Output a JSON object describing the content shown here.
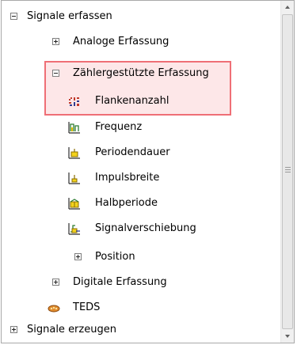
{
  "tree": {
    "items": [
      {
        "label": "Signale erfassen",
        "toggle": "minus",
        "icon": ""
      },
      {
        "label": "Analoge Erfassung",
        "toggle": "plus",
        "icon": ""
      },
      {
        "label": "Zählergestützte Erfassung",
        "toggle": "minus",
        "icon": ""
      },
      {
        "label": "Flankenanzahl",
        "toggle": "",
        "icon": "edge-count-icon"
      },
      {
        "label": "Frequenz",
        "toggle": "",
        "icon": "frequency-icon"
      },
      {
        "label": "Periodendauer",
        "toggle": "",
        "icon": "period-icon"
      },
      {
        "label": "Impulsbreite",
        "toggle": "",
        "icon": "pulse-width-icon"
      },
      {
        "label": "Halbperiode",
        "toggle": "",
        "icon": "semi-period-icon"
      },
      {
        "label": "Signalverschiebung",
        "toggle": "",
        "icon": "two-edge-separation-icon"
      },
      {
        "label": "Position",
        "toggle": "plus",
        "icon": ""
      },
      {
        "label": "Digitale Erfassung",
        "toggle": "plus",
        "icon": ""
      },
      {
        "label": "TEDS",
        "toggle": "",
        "icon": "teds-icon"
      },
      {
        "label": "Signale erzeugen",
        "toggle": "plus",
        "icon": ""
      }
    ],
    "highlight_color": "#ef6f76",
    "highlight_fill": "#fde7e8"
  }
}
